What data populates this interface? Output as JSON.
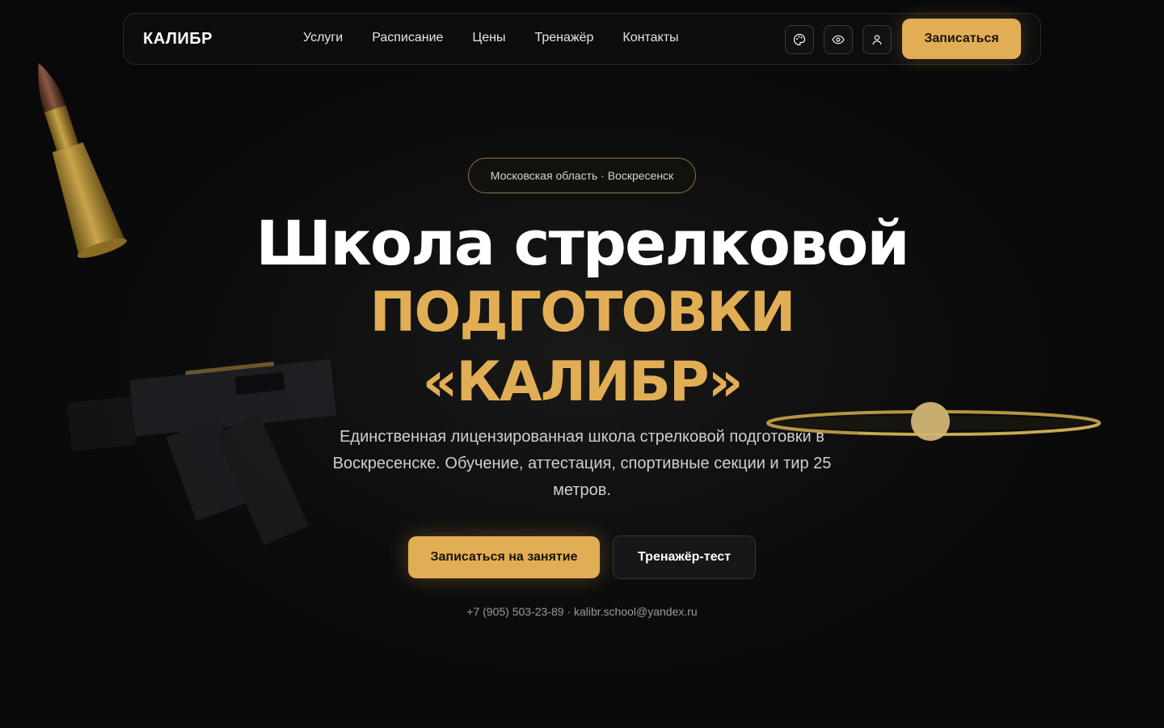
{
  "brand": "КАЛИБР",
  "nav": {
    "links": [
      "Услуги",
      "Расписание",
      "Цены",
      "Тренажёр",
      "Контакты"
    ],
    "icons": [
      "palette-icon",
      "eye-icon",
      "user-icon"
    ],
    "cta_label": "Записаться"
  },
  "hero": {
    "location": "Московская область · Воскресенск",
    "title_line1": "Школа стрелковой",
    "title_line2": "подготовки",
    "title_line3": "«КАЛИБР»",
    "description": "Единственная лицензированная школа стрелковой подготовки в Воскресенске. Обучение, аттестация, спортивные секции и тир 25 метров.",
    "primary_button": "Записаться на занятие",
    "secondary_button": "Тренажёр-тест",
    "contacts": "+7 (905) 503-23-89 · kalibr.school@yandex.ru"
  },
  "colors": {
    "background": "#0b0b0c",
    "accent": "#e2ae55",
    "text": "#ffffff"
  }
}
